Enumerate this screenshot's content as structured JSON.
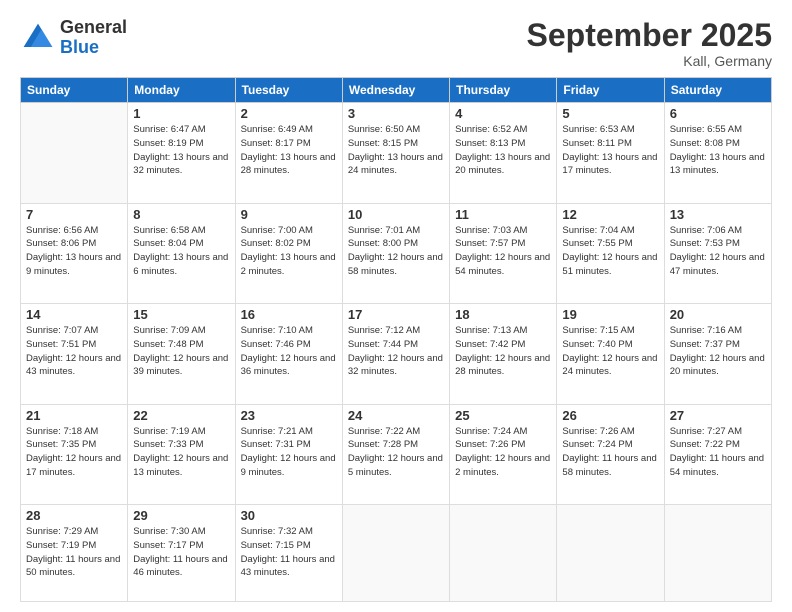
{
  "header": {
    "logo_general": "General",
    "logo_blue": "Blue",
    "title": "September 2025",
    "location": "Kall, Germany"
  },
  "days_of_week": [
    "Sunday",
    "Monday",
    "Tuesday",
    "Wednesday",
    "Thursday",
    "Friday",
    "Saturday"
  ],
  "weeks": [
    [
      {
        "day": "",
        "sunrise": "",
        "sunset": "",
        "daylight": ""
      },
      {
        "day": "1",
        "sunrise": "Sunrise: 6:47 AM",
        "sunset": "Sunset: 8:19 PM",
        "daylight": "Daylight: 13 hours and 32 minutes."
      },
      {
        "day": "2",
        "sunrise": "Sunrise: 6:49 AM",
        "sunset": "Sunset: 8:17 PM",
        "daylight": "Daylight: 13 hours and 28 minutes."
      },
      {
        "day": "3",
        "sunrise": "Sunrise: 6:50 AM",
        "sunset": "Sunset: 8:15 PM",
        "daylight": "Daylight: 13 hours and 24 minutes."
      },
      {
        "day": "4",
        "sunrise": "Sunrise: 6:52 AM",
        "sunset": "Sunset: 8:13 PM",
        "daylight": "Daylight: 13 hours and 20 minutes."
      },
      {
        "day": "5",
        "sunrise": "Sunrise: 6:53 AM",
        "sunset": "Sunset: 8:11 PM",
        "daylight": "Daylight: 13 hours and 17 minutes."
      },
      {
        "day": "6",
        "sunrise": "Sunrise: 6:55 AM",
        "sunset": "Sunset: 8:08 PM",
        "daylight": "Daylight: 13 hours and 13 minutes."
      }
    ],
    [
      {
        "day": "7",
        "sunrise": "Sunrise: 6:56 AM",
        "sunset": "Sunset: 8:06 PM",
        "daylight": "Daylight: 13 hours and 9 minutes."
      },
      {
        "day": "8",
        "sunrise": "Sunrise: 6:58 AM",
        "sunset": "Sunset: 8:04 PM",
        "daylight": "Daylight: 13 hours and 6 minutes."
      },
      {
        "day": "9",
        "sunrise": "Sunrise: 7:00 AM",
        "sunset": "Sunset: 8:02 PM",
        "daylight": "Daylight: 13 hours and 2 minutes."
      },
      {
        "day": "10",
        "sunrise": "Sunrise: 7:01 AM",
        "sunset": "Sunset: 8:00 PM",
        "daylight": "Daylight: 12 hours and 58 minutes."
      },
      {
        "day": "11",
        "sunrise": "Sunrise: 7:03 AM",
        "sunset": "Sunset: 7:57 PM",
        "daylight": "Daylight: 12 hours and 54 minutes."
      },
      {
        "day": "12",
        "sunrise": "Sunrise: 7:04 AM",
        "sunset": "Sunset: 7:55 PM",
        "daylight": "Daylight: 12 hours and 51 minutes."
      },
      {
        "day": "13",
        "sunrise": "Sunrise: 7:06 AM",
        "sunset": "Sunset: 7:53 PM",
        "daylight": "Daylight: 12 hours and 47 minutes."
      }
    ],
    [
      {
        "day": "14",
        "sunrise": "Sunrise: 7:07 AM",
        "sunset": "Sunset: 7:51 PM",
        "daylight": "Daylight: 12 hours and 43 minutes."
      },
      {
        "day": "15",
        "sunrise": "Sunrise: 7:09 AM",
        "sunset": "Sunset: 7:48 PM",
        "daylight": "Daylight: 12 hours and 39 minutes."
      },
      {
        "day": "16",
        "sunrise": "Sunrise: 7:10 AM",
        "sunset": "Sunset: 7:46 PM",
        "daylight": "Daylight: 12 hours and 36 minutes."
      },
      {
        "day": "17",
        "sunrise": "Sunrise: 7:12 AM",
        "sunset": "Sunset: 7:44 PM",
        "daylight": "Daylight: 12 hours and 32 minutes."
      },
      {
        "day": "18",
        "sunrise": "Sunrise: 7:13 AM",
        "sunset": "Sunset: 7:42 PM",
        "daylight": "Daylight: 12 hours and 28 minutes."
      },
      {
        "day": "19",
        "sunrise": "Sunrise: 7:15 AM",
        "sunset": "Sunset: 7:40 PM",
        "daylight": "Daylight: 12 hours and 24 minutes."
      },
      {
        "day": "20",
        "sunrise": "Sunrise: 7:16 AM",
        "sunset": "Sunset: 7:37 PM",
        "daylight": "Daylight: 12 hours and 20 minutes."
      }
    ],
    [
      {
        "day": "21",
        "sunrise": "Sunrise: 7:18 AM",
        "sunset": "Sunset: 7:35 PM",
        "daylight": "Daylight: 12 hours and 17 minutes."
      },
      {
        "day": "22",
        "sunrise": "Sunrise: 7:19 AM",
        "sunset": "Sunset: 7:33 PM",
        "daylight": "Daylight: 12 hours and 13 minutes."
      },
      {
        "day": "23",
        "sunrise": "Sunrise: 7:21 AM",
        "sunset": "Sunset: 7:31 PM",
        "daylight": "Daylight: 12 hours and 9 minutes."
      },
      {
        "day": "24",
        "sunrise": "Sunrise: 7:22 AM",
        "sunset": "Sunset: 7:28 PM",
        "daylight": "Daylight: 12 hours and 5 minutes."
      },
      {
        "day": "25",
        "sunrise": "Sunrise: 7:24 AM",
        "sunset": "Sunset: 7:26 PM",
        "daylight": "Daylight: 12 hours and 2 minutes."
      },
      {
        "day": "26",
        "sunrise": "Sunrise: 7:26 AM",
        "sunset": "Sunset: 7:24 PM",
        "daylight": "Daylight: 11 hours and 58 minutes."
      },
      {
        "day": "27",
        "sunrise": "Sunrise: 7:27 AM",
        "sunset": "Sunset: 7:22 PM",
        "daylight": "Daylight: 11 hours and 54 minutes."
      }
    ],
    [
      {
        "day": "28",
        "sunrise": "Sunrise: 7:29 AM",
        "sunset": "Sunset: 7:19 PM",
        "daylight": "Daylight: 11 hours and 50 minutes."
      },
      {
        "day": "29",
        "sunrise": "Sunrise: 7:30 AM",
        "sunset": "Sunset: 7:17 PM",
        "daylight": "Daylight: 11 hours and 46 minutes."
      },
      {
        "day": "30",
        "sunrise": "Sunrise: 7:32 AM",
        "sunset": "Sunset: 7:15 PM",
        "daylight": "Daylight: 11 hours and 43 minutes."
      },
      {
        "day": "",
        "sunrise": "",
        "sunset": "",
        "daylight": ""
      },
      {
        "day": "",
        "sunrise": "",
        "sunset": "",
        "daylight": ""
      },
      {
        "day": "",
        "sunrise": "",
        "sunset": "",
        "daylight": ""
      },
      {
        "day": "",
        "sunrise": "",
        "sunset": "",
        "daylight": ""
      }
    ]
  ]
}
